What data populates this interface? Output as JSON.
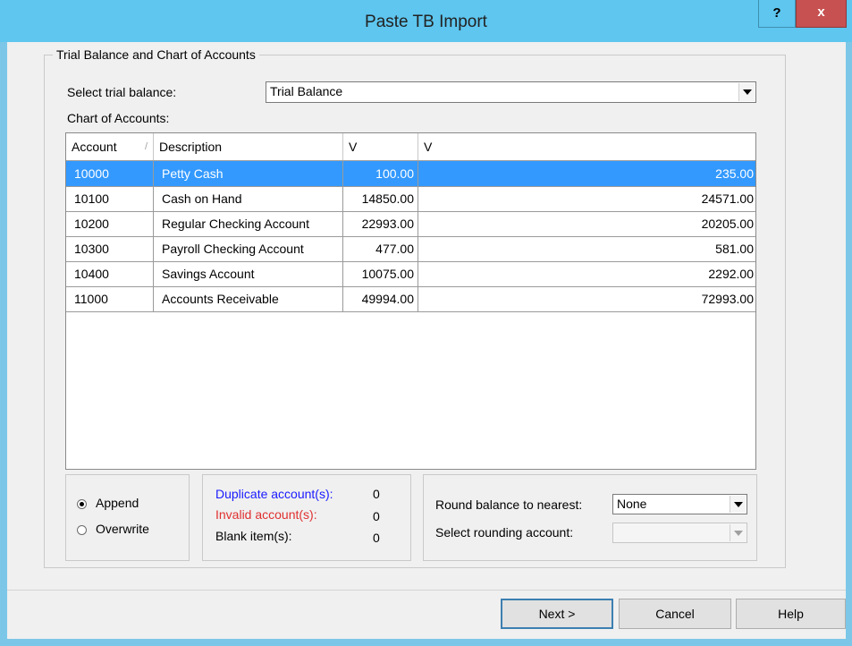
{
  "window": {
    "title": "Paste TB Import",
    "help_glyph": "?",
    "close_glyph": "x"
  },
  "group": {
    "title": "Trial Balance and Chart of Accounts"
  },
  "trial_balance": {
    "label": "Select trial balance:",
    "value": "Trial Balance"
  },
  "coa_label": "Chart of Accounts:",
  "grid": {
    "columns": [
      "Account",
      "Description",
      "V",
      "V"
    ],
    "sort_indicator": "/",
    "rows": [
      {
        "account": "10000",
        "description": "Petty Cash",
        "v1": "100.00",
        "v2": "235.00",
        "selected": true
      },
      {
        "account": "10100",
        "description": "Cash on Hand",
        "v1": "14850.00",
        "v2": "24571.00"
      },
      {
        "account": "10200",
        "description": "Regular Checking Account",
        "v1": "22993.00",
        "v2": "20205.00"
      },
      {
        "account": "10300",
        "description": "Payroll Checking Account",
        "v1": "477.00",
        "v2": "581.00"
      },
      {
        "account": "10400",
        "description": "Savings Account",
        "v1": "10075.00",
        "v2": "2292.00"
      },
      {
        "account": "11000",
        "description": "Accounts Receivable",
        "v1": "49994.00",
        "v2": "72993.00"
      }
    ]
  },
  "mode": {
    "append": "Append",
    "overwrite": "Overwrite",
    "selected": "append"
  },
  "stats": {
    "duplicate_label": "Duplicate account(s):",
    "duplicate_value": "0",
    "invalid_label": "Invalid account(s):",
    "invalid_value": "0",
    "blank_label": "Blank item(s):",
    "blank_value": "0"
  },
  "rounding": {
    "round_label": "Round balance to nearest:",
    "round_value": "None",
    "account_label": "Select rounding account:",
    "account_value": ""
  },
  "buttons": {
    "next": "Next >",
    "cancel": "Cancel",
    "help": "Help"
  },
  "colors": {
    "titlebar": "#5ec6ef",
    "selection": "#3399ff",
    "duplicate_text": "#1a1aff",
    "invalid_text": "#e03030",
    "close_button": "#c75050"
  }
}
